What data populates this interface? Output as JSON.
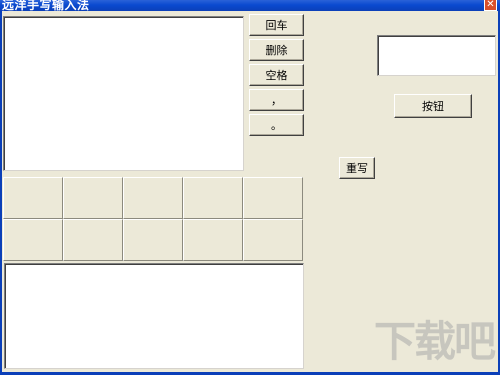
{
  "window": {
    "title": "远洋手写输入法",
    "close_glyph": "✕"
  },
  "buttons": {
    "enter": "回车",
    "delete": "删除",
    "space": "空格",
    "comma": "，",
    "period": "。",
    "rewrite": "重写",
    "button": "按钮"
  },
  "candidates": [
    "",
    "",
    "",
    "",
    "",
    "",
    "",
    "",
    "",
    ""
  ],
  "watermark": "下载吧"
}
